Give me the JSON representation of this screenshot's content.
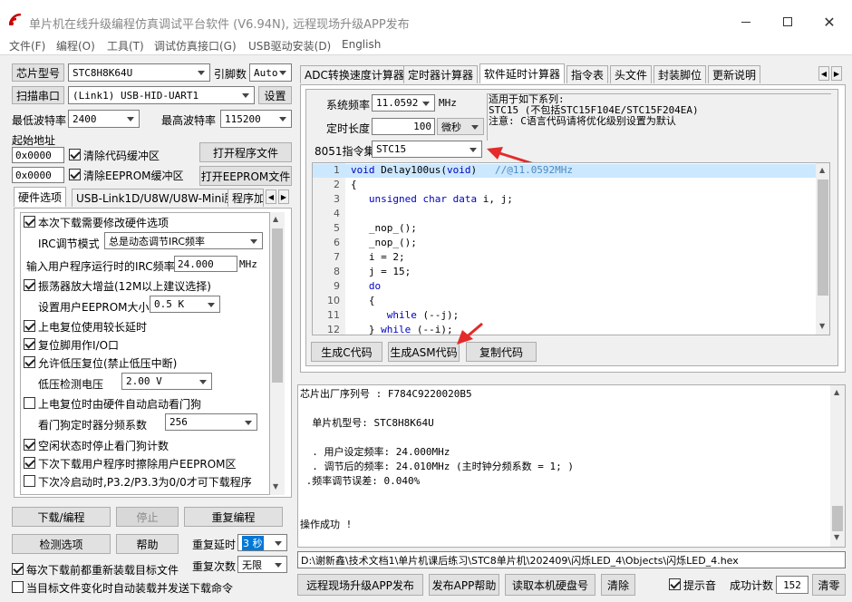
{
  "window": {
    "title": "单片机在线升级编程仿真调试平台软件 (V6.94N), 远程现场升级APP发布"
  },
  "menu": [
    "文件(F)",
    "编程(O)",
    "工具(T)",
    "调试仿真接口(G)",
    "USB驱动安装(D)",
    "English"
  ],
  "left": {
    "chip_label": "芯片型号",
    "chip_value": "STC8H8K64U",
    "pins_label": "引脚数",
    "pins_value": "Auto",
    "scan_label": "扫描串口",
    "port_value": "(Link1) USB-HID-UART1",
    "settings_label": "设置",
    "min_baud_label": "最低波特率",
    "min_baud": "2400",
    "max_baud_label": "最高波特率",
    "max_baud": "115200",
    "start_addr_label": "起始地址",
    "addr1": "0x0000",
    "clear_code_label": "清除代码缓冲区",
    "open_prog_label": "打开程序文件",
    "addr2": "0x0000",
    "clear_eeprom_label": "清除EEPROM缓冲区",
    "open_eeprom_label": "打开EEPROM文件",
    "tabs": [
      "硬件选项",
      "USB-Link1D/U8W/U8W-Mini脱机",
      "程序加"
    ],
    "hw": {
      "opt_modify": "本次下载需要修改硬件选项",
      "irc_mode_label": "IRC调节模式",
      "irc_mode": "总是动态调节IRC频率",
      "irc_freq_label": "输入用户程序运行时的IRC频率",
      "irc_freq": "24.000",
      "irc_unit": "MHz",
      "osc_gain": "振荡器放大增益(12M以上建议选择)",
      "eeprom_size_label": "设置用户EEPROM大小",
      "eeprom_size": "0.5 K",
      "por_delay": "上电复位使用较长延时",
      "reset_pin": "复位脚用作I/O口",
      "lvr": "允许低压复位(禁止低压中断)",
      "lv_label": "低压检测电压",
      "lv_value": "2.00 V",
      "wdt_hw": "上电复位时由硬件自动启动看门狗",
      "wdt_div_label": "看门狗定时器分频系数",
      "wdt_div": "256",
      "wdt_idle": "空闲状态时停止看门狗计数",
      "erase_eeprom": "下次下载用户程序时擦除用户EEPROM区",
      "p32_label": "下次冷启动时,P3.2/P3.3为0/0才可下载程序"
    },
    "btn_download": "下载/编程",
    "btn_stop": "停止",
    "btn_reprog": "重复编程",
    "btn_detect": "检测选项",
    "btn_help": "帮助",
    "repeat_delay_label": "重复延时",
    "repeat_delay": "3 秒",
    "reload_label": "每次下载前都重新装载目标文件",
    "repeat_count_label": "重复次数",
    "repeat_count": "无限",
    "auto_label": "当目标文件变化时自动装载并发送下载命令"
  },
  "right": {
    "tabs": [
      "ADC转换速度计算器",
      "定时器计算器",
      "软件延时计算器",
      "指令表",
      "头文件",
      "封装脚位",
      "更新说明"
    ],
    "sys_freq_label": "系统频率",
    "sys_freq": "11.0592",
    "sys_freq_unit": "MHz",
    "note": [
      "适用于如下系列:",
      "STC15 (不包括STC15F104E/STC15F204EA)",
      "注意: C语言代码请将优化级别设置为默认"
    ],
    "delay_label": "定时长度",
    "delay": "100",
    "delay_unit": "微秒",
    "isa_label": "8051指令集",
    "isa": "STC15",
    "code": [
      {
        "n": "1",
        "t": "void Delay100us(void)\t//@11.0592MHz"
      },
      {
        "n": "2",
        "t": "{"
      },
      {
        "n": "3",
        "t": "\tunsigned char data i, j;"
      },
      {
        "n": "4",
        "t": ""
      },
      {
        "n": "5",
        "t": "\t_nop_();"
      },
      {
        "n": "6",
        "t": "\t_nop_();"
      },
      {
        "n": "7",
        "t": "\ti = 2;"
      },
      {
        "n": "8",
        "t": "\tj = 15;"
      },
      {
        "n": "9",
        "t": "\tdo"
      },
      {
        "n": "10",
        "t": "\t{"
      },
      {
        "n": "11",
        "t": "\t\twhile (--j);"
      },
      {
        "n": "12",
        "t": "\t} while (--i);"
      }
    ],
    "btn_gen_c": "生成C代码",
    "btn_gen_asm": "生成ASM代码",
    "btn_copy": "复制代码",
    "log": [
      "芯片出厂序列号 : F784C9220020B5",
      "",
      "  单片机型号: STC8H8K64U",
      "",
      "  . 用户设定频率: 24.000MHz",
      "  . 调节后的频率: 24.010MHz (主时钟分频系数 = 1; )",
      " .频率调节误差: 0.040%",
      "",
      "",
      "操作成功 !"
    ],
    "path": "D:\\谢新鑫\\技术文档1\\单片机课后练习\\STC8单片机\\202409\\闪烁LED_4\\Objects\\闪烁LED_4.hex",
    "btn_remote": "远程现场升级APP发布",
    "btn_publish_help": "发布APP帮助",
    "btn_read_hd": "读取本机硬盘号",
    "btn_clear": "清除",
    "beep_label": "提示音",
    "success_label": "成功计数",
    "success_count": "152",
    "btn_zero": "清零"
  }
}
